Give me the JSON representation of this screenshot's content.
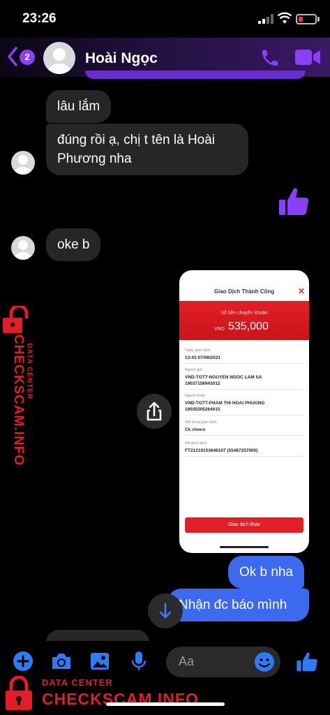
{
  "status_bar": {
    "time": "23:26"
  },
  "header": {
    "unread_count": "2",
    "contact_name": "Hoài Ngọc",
    "accent": "#8a3ffc"
  },
  "messages": [
    {
      "from": "them",
      "text": "lâu lắm"
    },
    {
      "from": "them",
      "text": "đúng rồi ạ, chị t tên là Hoài Phương nha"
    },
    {
      "from": "me",
      "type": "like"
    },
    {
      "from": "them",
      "text": "oke b"
    },
    {
      "from": "me",
      "type": "image"
    },
    {
      "from": "me",
      "text": "Ok b nha"
    },
    {
      "from": "me",
      "text": "Nhận đc báo mình"
    }
  ],
  "receipt": {
    "title": "Giao Dịch Thành Công",
    "amount_label": "Số tiền chuyển khoản",
    "currency": "VND",
    "amount": "535,000",
    "fields": [
      {
        "label": "Ngày giao dịch",
        "value": "13:43 07/08/2021"
      },
      {
        "label": "Người gửi",
        "value": "VND-TGTT-NGUYEN NGOC LAM SA",
        "value2": "19037156943012"
      },
      {
        "label": "Người nhận",
        "value": "VND-TGTT-PHAM THI HOAI PHUONG",
        "value2": "19035305264015"
      },
      {
        "label": "Nội dung giao dịch",
        "value": "Ck choco"
      },
      {
        "label": "Mã giao dịch",
        "value": "FT21219153646107 (55487257000)"
      }
    ],
    "button": "Giao dịch khác",
    "brand_color": "#e31e24"
  },
  "composer": {
    "placeholder": "Aa"
  },
  "watermark": {
    "small": "DATA CENTER",
    "big": "CHECKSCAM.INFO",
    "color": "#e21d25"
  }
}
